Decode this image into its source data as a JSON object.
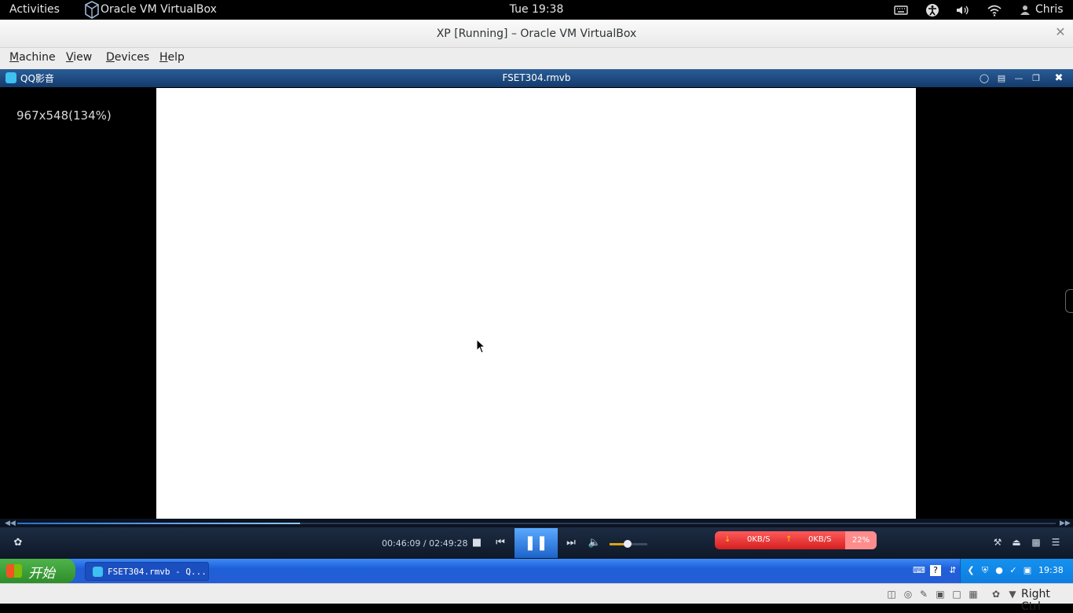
{
  "topbar": {
    "activities": "Activities",
    "app_name": "Oracle VM VirtualBox",
    "clock": "Tue 19:38",
    "user": "Chris",
    "icons": [
      "keyboard-icon",
      "accessibility-icon",
      "volume-icon",
      "wifi-icon",
      "user-icon"
    ]
  },
  "vbox": {
    "window_title": "XP [Running] – Oracle VM VirtualBox",
    "close_glyph": "✕",
    "menu": [
      {
        "label": "Machine",
        "accel": "M"
      },
      {
        "label": "View",
        "accel": "V"
      },
      {
        "label": "Devices",
        "accel": "D"
      },
      {
        "label": "Help",
        "accel": "H"
      }
    ],
    "host_key": "Right Ctrl"
  },
  "player": {
    "app_name": "QQ影音",
    "file_title": "FSET304.rmvb",
    "resolution_info": "967x548(134%)",
    "time_display": "00:46:09 / 02:49:28",
    "progress_fraction": 0.272,
    "volume_fraction": 0.48,
    "net_down": "0KB/S",
    "net_up": "0KB/S",
    "net_percent": "22%",
    "colors": {
      "title_bar": "#1f4d86",
      "accent": "#2d6fd0",
      "net_box": "#e83333"
    }
  },
  "xp": {
    "start_label": "开始",
    "task_item": "FSET304.rmvb - Q...",
    "clock": "19:38"
  }
}
